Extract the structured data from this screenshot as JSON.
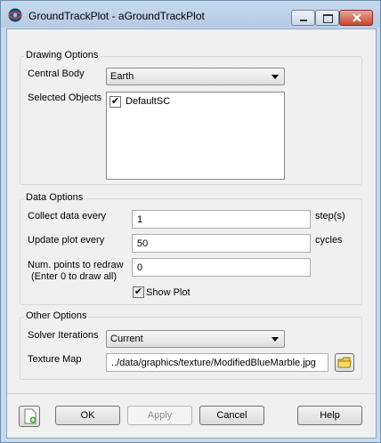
{
  "window": {
    "title": "GroundTrackPlot - aGroundTrackPlot"
  },
  "drawing_options": {
    "legend": "Drawing Options",
    "central_body_label": "Central Body",
    "central_body_value": "Earth",
    "selected_objects_label": "Selected Objects",
    "objects": [
      {
        "label": "DefaultSC",
        "checked": true
      }
    ]
  },
  "data_options": {
    "legend": "Data Options",
    "collect_label": "Collect data every",
    "collect_value": "1",
    "collect_unit": "step(s)",
    "update_label": "Update plot every",
    "update_value": "50",
    "update_unit": "cycles",
    "num_points_label": "Num. points to redraw",
    "num_points_hint": "(Enter 0 to draw all)",
    "num_points_value": "0",
    "show_plot_label": "Show Plot",
    "show_plot_checked": true
  },
  "other_options": {
    "legend": "Other Options",
    "solver_label": "Solver Iterations",
    "solver_value": "Current",
    "texture_label": "Texture Map",
    "texture_value": "../data/graphics/texture/ModifiedBlueMarble.jpg"
  },
  "buttons": {
    "ok": "OK",
    "apply": "Apply",
    "cancel": "Cancel",
    "help": "Help"
  },
  "icons": {
    "app": "gmat-globe-icon",
    "browse": "folder-icon",
    "script": "new-script-icon"
  }
}
